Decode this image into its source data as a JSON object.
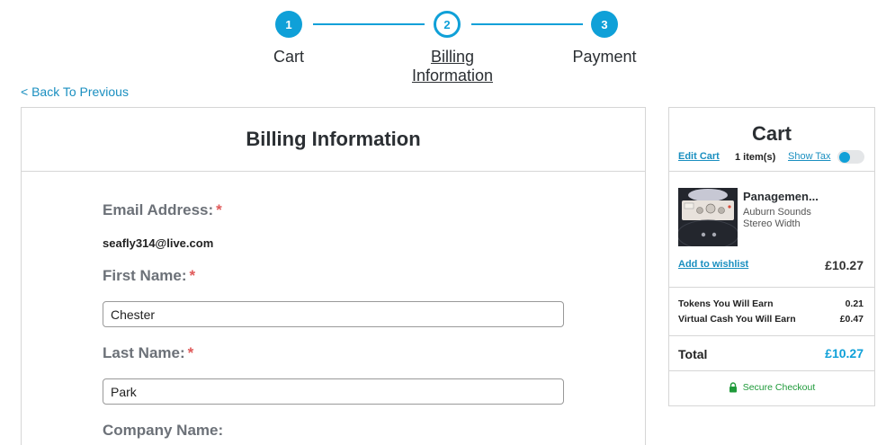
{
  "stepper": {
    "steps": [
      {
        "number": "1",
        "label": "Cart",
        "label2": ""
      },
      {
        "number": "2",
        "label": "Billing",
        "label2": "Information"
      },
      {
        "number": "3",
        "label": "Payment",
        "label2": ""
      }
    ],
    "current_step": 2
  },
  "back_link": "< Back To Previous",
  "billing": {
    "title": "Billing Information",
    "email_label": "Email Address:",
    "email_value": "seafly314@live.com",
    "first_name_label": "First Name:",
    "first_name_value": "Chester",
    "last_name_label": "Last Name:",
    "last_name_value": "Park",
    "company_label": "Company Name:",
    "required_mark": "*"
  },
  "cart": {
    "title": "Cart",
    "edit_cart": "Edit Cart",
    "items_count": "1 item(s)",
    "show_tax": "Show Tax",
    "show_tax_on": true,
    "item": {
      "name": "Panagemen...",
      "brand": "Auburn Sounds",
      "category": "Stereo Width",
      "price": "£10.27",
      "add_to_wishlist": "Add to wishlist"
    },
    "tokens_label": "Tokens You Will Earn",
    "tokens_value": "0.21",
    "cash_label": "Virtual Cash You Will Earn",
    "cash_value": "£0.47",
    "total_label": "Total",
    "total_value": "£10.27",
    "secure_checkout": "Secure Checkout"
  },
  "colors": {
    "accent": "#0fa0d8",
    "link": "#1a8fc0",
    "required": "#e05a5a",
    "secure": "#1f9a3a"
  }
}
